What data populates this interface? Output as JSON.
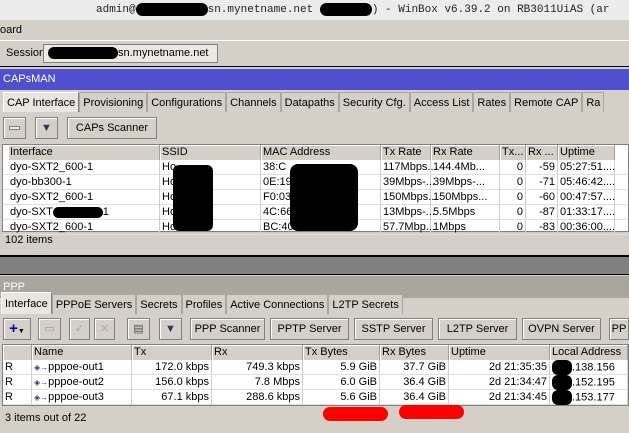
{
  "window": {
    "title_prefix": "admin@",
    "title_host": "sn.mynetname.net",
    "title_suffix": ") - WinBox v6.39.2 on RB3011UiAS (ar"
  },
  "menu": {
    "item": "oard"
  },
  "session": {
    "label": "Session:",
    "value": "sn.mynetname.net"
  },
  "capsman": {
    "title": "CAPsMAN",
    "header_color": "#4f4fcf",
    "tabs": [
      "CAP Interface",
      "Provisioning",
      "Configurations",
      "Channels",
      "Datapaths",
      "Security Cfg.",
      "Access List",
      "Rates",
      "Remote CAP",
      "Ra"
    ],
    "toolbar": {
      "scanner": "CAPs Scanner"
    },
    "columns": [
      "Interface",
      "SSID",
      "MAC Address",
      "Tx Rate",
      "Rx Rate",
      "Tx...",
      "Rx ...",
      "Uptime"
    ],
    "rows": [
      {
        "interface": "dyo-SXT2_600-1",
        "ssid": "Ho",
        "mac": "38:C",
        "tx_rate": "117Mbps...",
        "rx_rate": "144.4Mb...",
        "tx": "0",
        "rx": "-59",
        "uptime": "05:27:51...."
      },
      {
        "interface": "dyo-bb300-1",
        "ssid": "Ho",
        "mac": "0E:19",
        "tx_rate": "39Mbps-...",
        "rx_rate": "39Mbps-...",
        "tx": "0",
        "rx": "-71",
        "uptime": "05:46:42...."
      },
      {
        "interface": "dyo-SXT2_600-1",
        "ssid": "Ho",
        "mac": "F0:03",
        "tx_rate": "150Mbps...",
        "rx_rate": "150Mbps...",
        "tx": "0",
        "rx": "-60",
        "uptime": "00:47:57...."
      },
      {
        "interface": "dyo-SXT",
        "interface_end": "1",
        "ssid": "Ho",
        "mac": "4C:66",
        "tx_rate": "13Mbps-...",
        "rx_rate": "5.5Mbps",
        "tx": "0",
        "rx": "-87",
        "uptime": "01:33:17...."
      },
      {
        "interface": "dyo-SXT2_600-1",
        "ssid": "Ho",
        "mac": "BC:40",
        "tx_rate": "57.7Mbp...",
        "rx_rate": "1Mbps",
        "tx": "0",
        "rx": "-83",
        "uptime": "00:36:00...."
      }
    ],
    "status": "102 items"
  },
  "ppp": {
    "title": "PPP",
    "header_color": "#aaa69e",
    "tabs": [
      "Interface",
      "PPPoE Servers",
      "Secrets",
      "Profiles",
      "Active Connections",
      "L2TP Secrets"
    ],
    "toolbar": [
      "PPP Scanner",
      "PPTP Server",
      "SSTP Server",
      "L2TP Server",
      "OVPN Server",
      "PP"
    ],
    "columns": [
      "",
      "Name",
      "Tx",
      "Rx",
      "Tx Bytes",
      "Rx Bytes",
      "Uptime",
      "Local Address"
    ],
    "rows": [
      {
        "flag": "R",
        "name": "pppoe-out1",
        "tx": "172.0 kbps",
        "rx": "749.3 kbps",
        "tx_bytes": "5.9 GiB",
        "rx_bytes": "37.7 GiB",
        "uptime": "2d 21:35:35",
        "local": ".138.156"
      },
      {
        "flag": "R",
        "name": "pppoe-out2",
        "tx": "156.0 kbps",
        "rx": "7.8 Mbps",
        "tx_bytes": "6.0 GiB",
        "rx_bytes": "36.4 GiB",
        "uptime": "2d 21:34:47",
        "local": ".152.195"
      },
      {
        "flag": "R",
        "name": "pppoe-out3",
        "tx": "67.1 kbps",
        "rx": "288.6 kbps",
        "tx_bytes": "5.6 GiB",
        "rx_bytes": "36.4 GiB",
        "uptime": "2d 21:34:45",
        "local": ".153.177"
      }
    ],
    "status": "3 items out of 22",
    "highlight_color": "#ff0000"
  }
}
